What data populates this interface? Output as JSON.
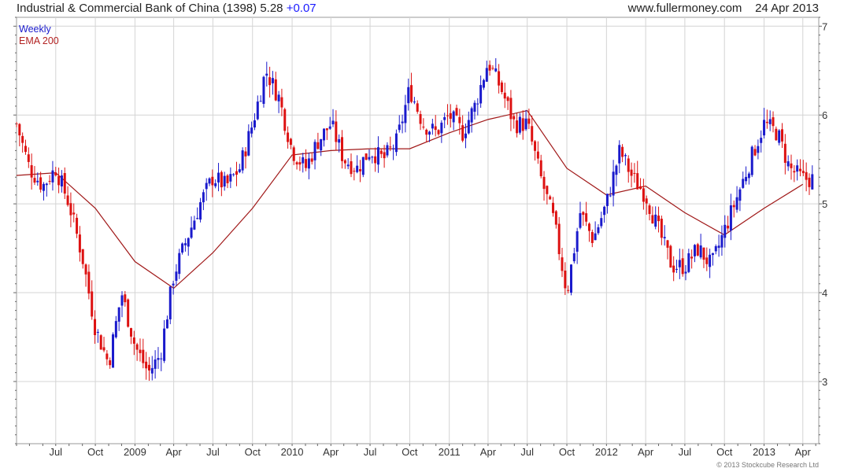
{
  "header": {
    "name": "Industrial & Commercial Bank of China (1398)",
    "price": "5.28",
    "change": "+0.07",
    "site": "www.fullermoney.com",
    "date": "24 Apr 2013"
  },
  "legend": {
    "period": "Weekly",
    "indicator": "EMA 200"
  },
  "copyright": "© 2013 Stockcube Research Ltd",
  "colors": {
    "up": "#1a1acc",
    "down": "#dd1111",
    "ema": "#a01818",
    "grid": "#d4d4d4"
  },
  "chart_data": {
    "type": "candlestick",
    "title": "Industrial & Commercial Bank of China (1398) 5.28 +0.07",
    "x_tick_labels": [
      "Jul",
      "Oct",
      "2009",
      "Apr",
      "Jul",
      "Oct",
      "2010",
      "Apr",
      "Jul",
      "Oct",
      "2011",
      "Apr",
      "Jul",
      "Oct",
      "2012",
      "Apr",
      "Jul",
      "Oct",
      "2013",
      "Apr"
    ],
    "y_tick_labels": [
      "3",
      "4",
      "5",
      "6",
      "7"
    ],
    "ylim": [
      2.3,
      7.1
    ],
    "grid": true,
    "legend_position": "top-left",
    "price_path": [
      [
        "2008-04",
        5.9
      ],
      [
        "2008-05",
        5.4
      ],
      [
        "2008-06",
        5.2
      ],
      [
        "2008-07",
        5.4
      ],
      [
        "2008-08",
        5.0
      ],
      [
        "2008-09",
        4.4
      ],
      [
        "2008-10",
        3.6
      ],
      [
        "2008-11",
        3.2
      ],
      [
        "2008-12",
        4.0
      ],
      [
        "2009-01",
        3.4
      ],
      [
        "2009-02",
        3.1
      ],
      [
        "2009-03",
        3.3
      ],
      [
        "2009-04",
        4.2
      ],
      [
        "2009-05",
        4.6
      ],
      [
        "2009-06",
        5.0
      ],
      [
        "2009-07",
        5.3
      ],
      [
        "2009-08",
        5.2
      ],
      [
        "2009-09",
        5.4
      ],
      [
        "2009-10",
        5.9
      ],
      [
        "2009-11",
        6.5
      ],
      [
        "2009-12",
        6.2
      ],
      [
        "2010-01",
        5.6
      ],
      [
        "2010-02",
        5.4
      ],
      [
        "2010-03",
        5.7
      ],
      [
        "2010-04",
        5.9
      ],
      [
        "2010-05",
        5.5
      ],
      [
        "2010-06",
        5.4
      ],
      [
        "2010-07",
        5.6
      ],
      [
        "2010-08",
        5.5
      ],
      [
        "2010-09",
        5.7
      ],
      [
        "2010-10",
        6.3
      ],
      [
        "2010-11",
        5.9
      ],
      [
        "2010-12",
        5.8
      ],
      [
        "2011-01",
        6.0
      ],
      [
        "2011-02",
        5.8
      ],
      [
        "2011-03",
        6.1
      ],
      [
        "2011-04",
        6.6
      ],
      [
        "2011-05",
        6.3
      ],
      [
        "2011-06",
        5.9
      ],
      [
        "2011-07",
        5.9
      ],
      [
        "2011-08",
        5.3
      ],
      [
        "2011-09",
        4.8
      ],
      [
        "2011-10",
        4.0
      ],
      [
        "2011-11",
        4.9
      ],
      [
        "2011-12",
        4.6
      ],
      [
        "2012-01",
        5.0
      ],
      [
        "2012-02",
        5.6
      ],
      [
        "2012-03",
        5.3
      ],
      [
        "2012-04",
        5.1
      ],
      [
        "2012-05",
        4.7
      ],
      [
        "2012-06",
        4.3
      ],
      [
        "2012-07",
        4.3
      ],
      [
        "2012-08",
        4.5
      ],
      [
        "2012-09",
        4.3
      ],
      [
        "2012-10",
        4.7
      ],
      [
        "2012-11",
        5.1
      ],
      [
        "2012-12",
        5.5
      ],
      [
        "2013-01",
        5.9
      ],
      [
        "2013-02",
        5.8
      ],
      [
        "2013-03",
        5.4
      ],
      [
        "2013-04",
        5.28
      ]
    ],
    "ema200_path": [
      [
        "2008-04",
        5.32
      ],
      [
        "2008-07",
        5.35
      ],
      [
        "2008-10",
        4.95
      ],
      [
        "2009-01",
        4.35
      ],
      [
        "2009-04",
        4.05
      ],
      [
        "2009-07",
        4.45
      ],
      [
        "2009-10",
        4.95
      ],
      [
        "2010-01",
        5.55
      ],
      [
        "2010-04",
        5.6
      ],
      [
        "2010-07",
        5.62
      ],
      [
        "2010-10",
        5.62
      ],
      [
        "2011-01",
        5.8
      ],
      [
        "2011-04",
        5.95
      ],
      [
        "2011-07",
        6.05
      ],
      [
        "2011-10",
        5.4
      ],
      [
        "2012-01",
        5.1
      ],
      [
        "2012-04",
        5.2
      ],
      [
        "2012-07",
        4.9
      ],
      [
        "2012-10",
        4.65
      ],
      [
        "2013-01",
        4.95
      ],
      [
        "2013-04",
        5.22
      ]
    ]
  }
}
